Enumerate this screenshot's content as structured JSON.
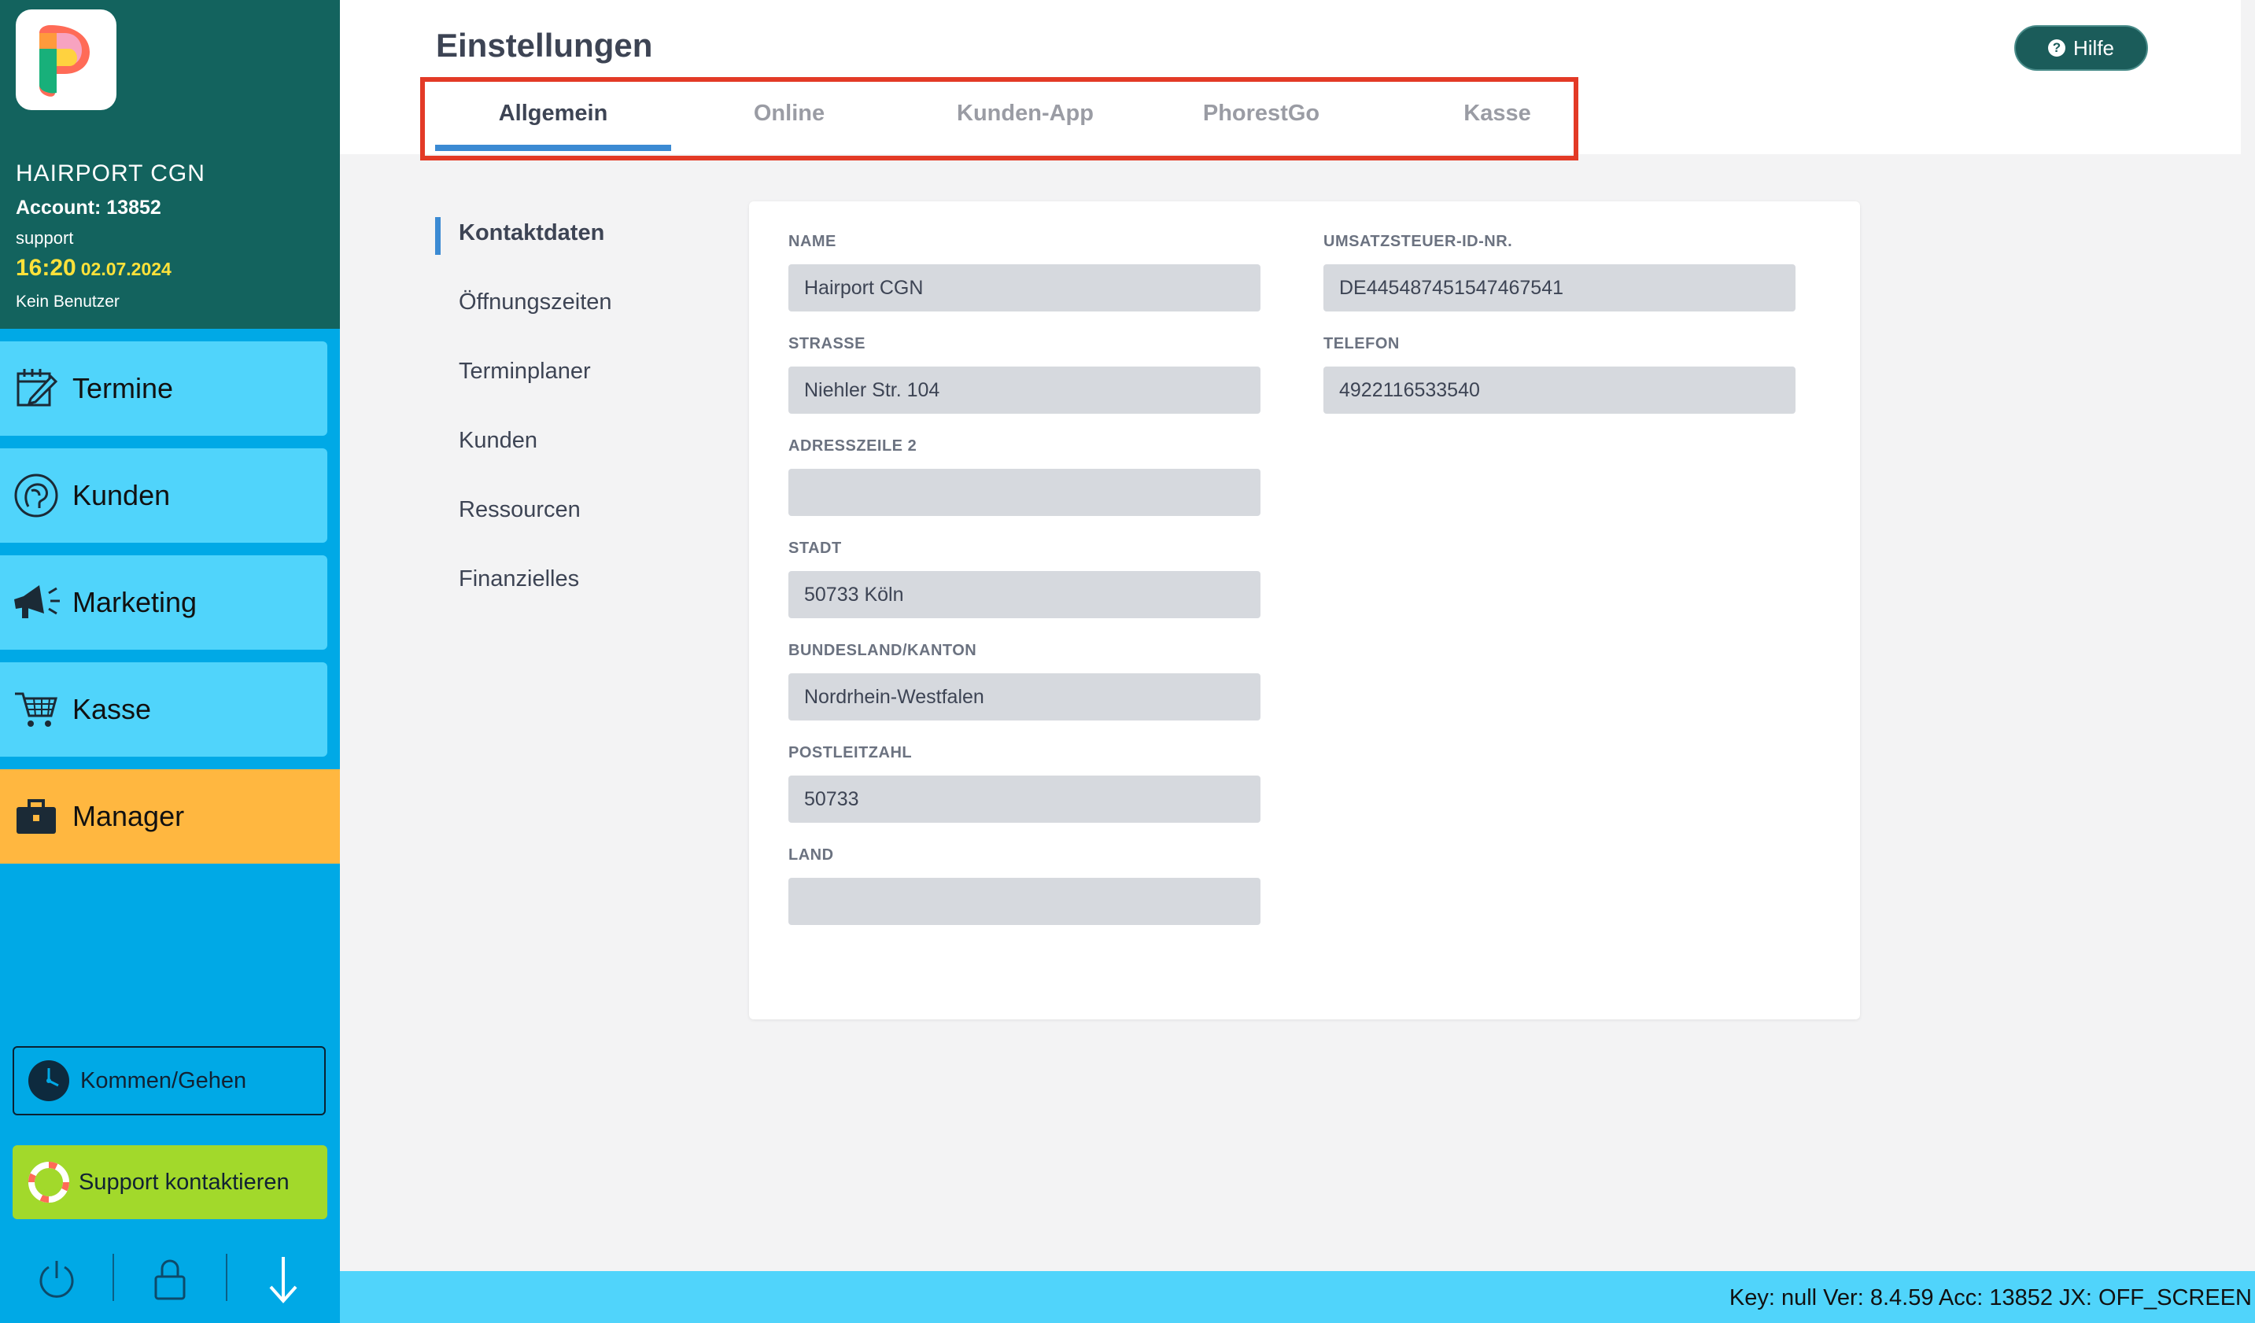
{
  "sidebar": {
    "salon_name": "HAIRPORT CGN",
    "account": "Account: 13852",
    "user": "support",
    "time": "16:20",
    "date": "02.07.2024",
    "no_user": "Kein Benutzer",
    "nav": [
      {
        "label": "Termine",
        "icon": "calendar-edit-icon"
      },
      {
        "label": "Kunden",
        "icon": "customer-head-icon"
      },
      {
        "label": "Marketing",
        "icon": "megaphone-icon"
      },
      {
        "label": "Kasse",
        "icon": "shopping-cart-icon"
      },
      {
        "label": "Manager",
        "icon": "briefcase-icon"
      }
    ],
    "kommen_gehen": "Kommen/Gehen",
    "support": "Support kontaktieren",
    "bottom_icons": [
      "power-icon",
      "lock-icon",
      "arrow-down-icon"
    ]
  },
  "header": {
    "title": "Einstellungen",
    "help": "Hilfe",
    "tabs": [
      "Allgemein",
      "Online",
      "Kunden-App",
      "PhorestGo",
      "Kasse"
    ],
    "active_tab": "Allgemein"
  },
  "subnav": {
    "items": [
      "Kontaktdaten",
      "Öffnungszeiten",
      "Terminplaner",
      "Kunden",
      "Ressourcen",
      "Finanzielles"
    ],
    "active": "Kontaktdaten"
  },
  "form": {
    "name": {
      "label": "NAME",
      "value": "Hairport CGN"
    },
    "strasse": {
      "label": "STRASSE",
      "value": "Niehler Str. 104"
    },
    "adresszeile2": {
      "label": "ADRESSZEILE 2",
      "value": ""
    },
    "stadt": {
      "label": "STADT",
      "value": "50733 Köln"
    },
    "bundesland": {
      "label": "BUNDESLAND/KANTON",
      "value": "Nordrhein-Westfalen"
    },
    "postleitzahl": {
      "label": "POSTLEITZAHL",
      "value": "50733"
    },
    "land": {
      "label": "LAND",
      "value": ""
    },
    "ust_id": {
      "label": "UMSATZSTEUER-ID-NR.",
      "value": "DE445487451547467541"
    },
    "telefon": {
      "label": "TELEFON",
      "value": "4922116533540"
    }
  },
  "statusbar": {
    "text": "Key: null Ver: 8.4.59 Acc: 13852  JX: OFF_SCREEN"
  },
  "colors": {
    "sidebar_head": "#13635e",
    "sidebar_bg": "#00a9e6",
    "nav_item": "#50d4fb",
    "manager": "#ffb740",
    "support": "#a2d92b",
    "tab_accent": "#3b8ad3",
    "highlight": "#e33a26"
  }
}
